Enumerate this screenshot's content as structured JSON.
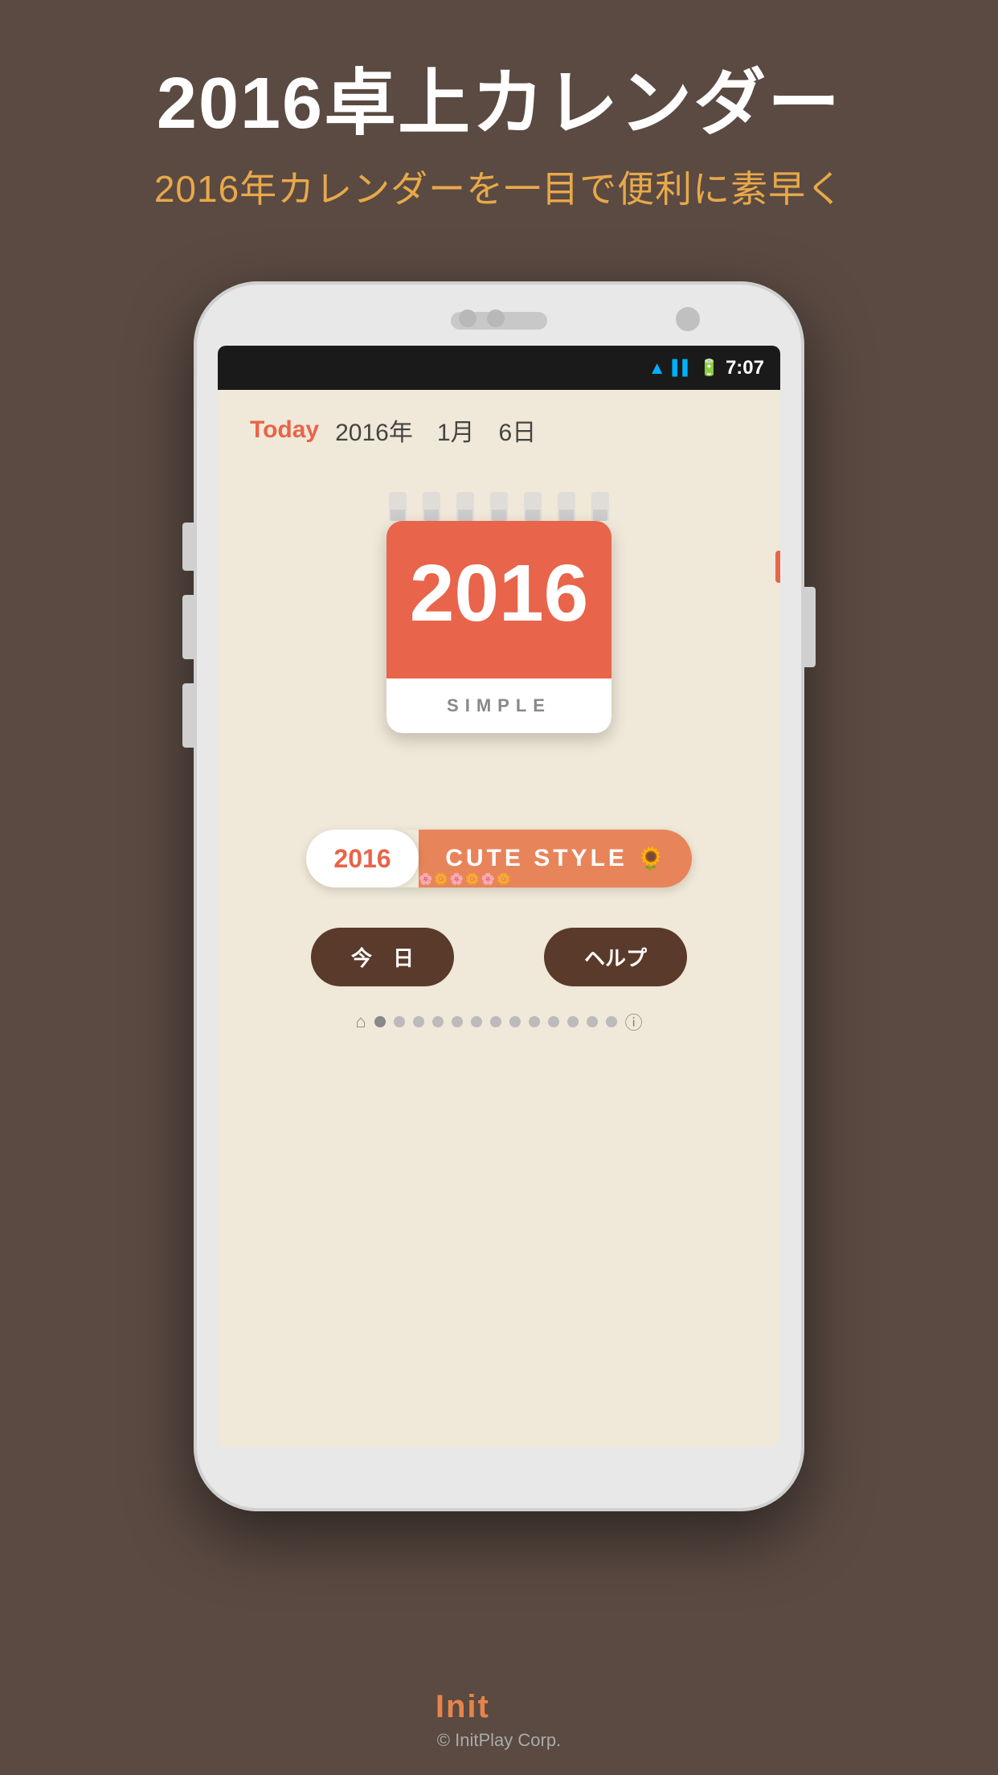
{
  "background": {
    "color": "#5a4a42"
  },
  "header": {
    "main_title": "2016卓上カレンダー",
    "sub_title": "2016年カレンダーを一目で便利に素早く"
  },
  "status_bar": {
    "time": "7:07",
    "wifi": "WiFi",
    "signal": "Signal",
    "battery": "Battery"
  },
  "app": {
    "today_label": "Today",
    "date": "2016年　1月　6日",
    "calendar_year": "2016",
    "calendar_word": "SIMPLE",
    "cute_banner": {
      "year": "2016",
      "text": "CUTE STYLE"
    },
    "btn_today": "今　日",
    "btn_help": "ヘルプ",
    "dots_count": 14
  },
  "brand": {
    "name": "InitPlay",
    "corp": "© InitPlay Corp."
  }
}
